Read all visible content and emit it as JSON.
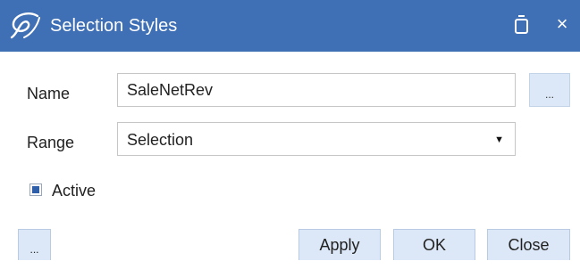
{
  "window": {
    "title": "Selection Styles",
    "logo_icon": "app-logo-icon",
    "restore_icon": "restore-icon",
    "close_glyph": "×",
    "titlebar_color": "#3f6fb5"
  },
  "form": {
    "name_label": "Name",
    "name_value": "SaleNetRev",
    "browse_label": "...",
    "range_label": "Range",
    "range_value": "Selection",
    "range_arrow": "▼",
    "active_label": "Active",
    "active_checked": true
  },
  "footer": {
    "more_label": "...",
    "apply_label": "Apply",
    "ok_label": "OK",
    "close_label": "Close",
    "button_color": "#dce8f7"
  }
}
